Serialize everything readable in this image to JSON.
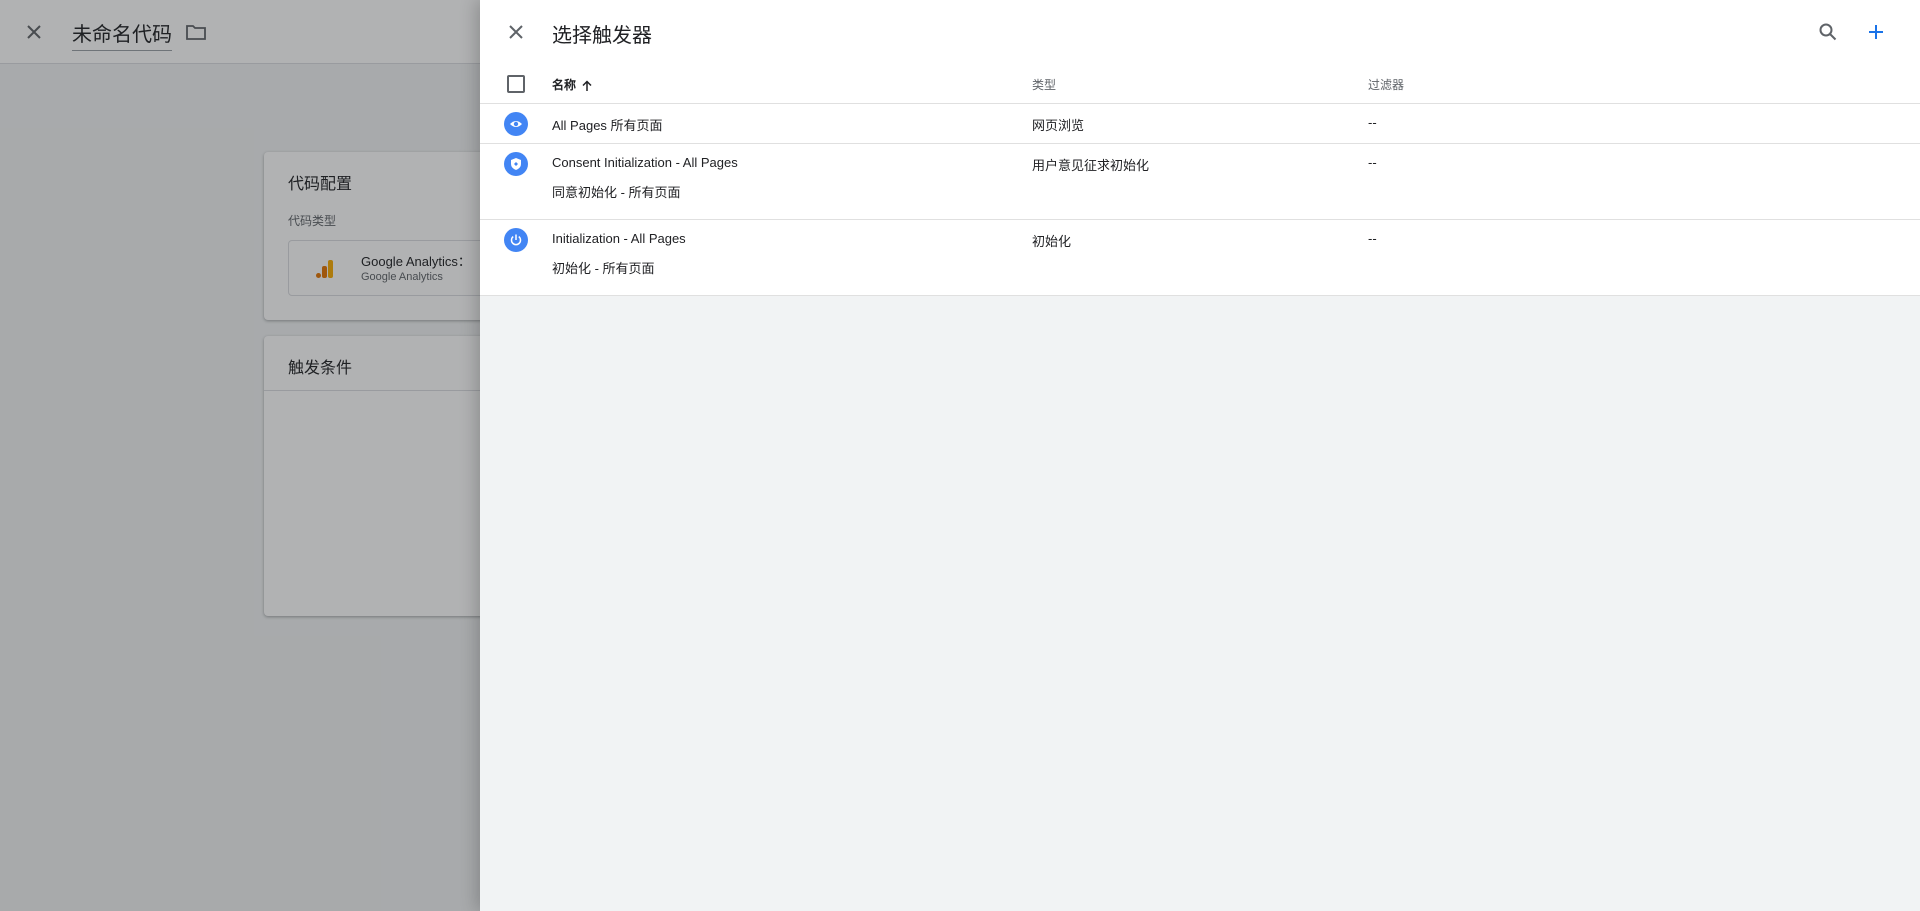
{
  "background": {
    "title": "未命名代码",
    "config_card": {
      "title": "代码配置",
      "type_label": "代码类型",
      "tag_name": "Google Analytics：",
      "tag_sub": "Google Analytics"
    },
    "trigger_card": {
      "title": "触发条件"
    }
  },
  "drawer": {
    "title": "选择触发器",
    "columns": {
      "name": "名称",
      "type": "类型",
      "filter": "过滤器"
    },
    "rows": [
      {
        "icon": "eye-icon",
        "name": "All Pages 所有页面",
        "name2": "",
        "type": "网页浏览",
        "filter": "--"
      },
      {
        "icon": "shield-icon",
        "name": "Consent Initialization - All Pages",
        "name2": "同意初始化 - 所有页面",
        "type": "用户意见征求初始化",
        "filter": "--"
      },
      {
        "icon": "power-icon",
        "name": "Initialization - All Pages",
        "name2": "初始化 - 所有页面",
        "type": "初始化",
        "filter": "--"
      }
    ]
  },
  "colors": {
    "accent": "#1a73e8",
    "icon_blue": "#4285f4",
    "ga_orange": "#f9ab00",
    "ga_dark": "#e37400"
  }
}
